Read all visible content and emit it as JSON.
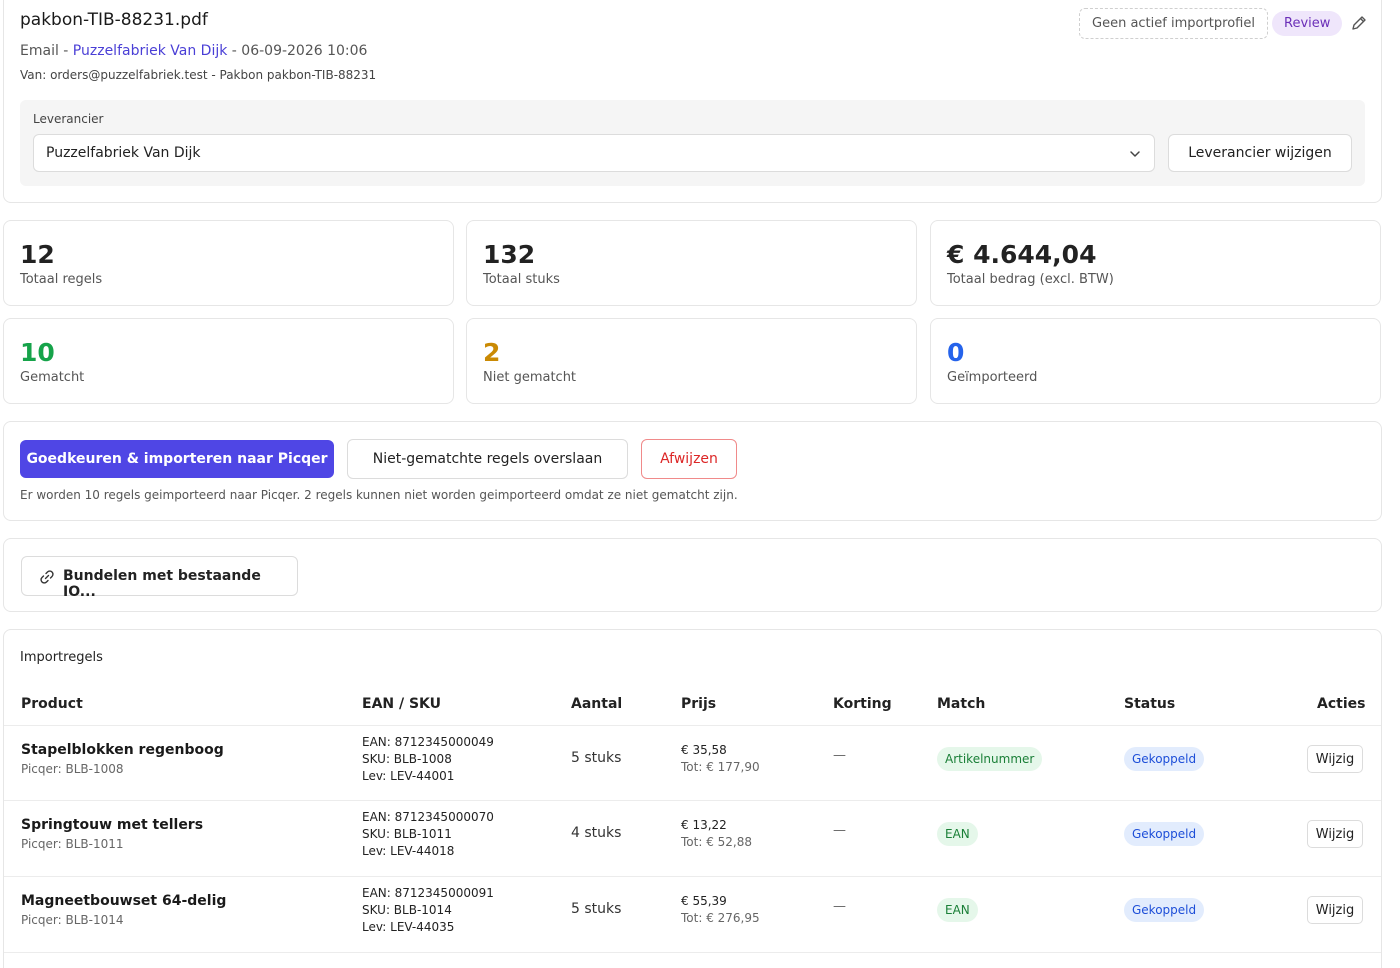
{
  "header": {
    "file_title": "pakbon-TIB-88231.pdf",
    "source": "Email",
    "sep1": " - ",
    "supplier_link": "Puzzelfabriek Van Dijk",
    "sep2": " - ",
    "datetime": "06-09-2026 10:06",
    "from_line": "Van: orders@puzzelfabriek.test - Pakbon pakbon-TIB-88231",
    "profile_badge": "Geen actief importprofiel",
    "review_badge": "Review",
    "edit_icon": "pencil-icon"
  },
  "supplier": {
    "label": "Leverancier",
    "selected": "Puzzelfabriek Van Dijk",
    "change_button": "Leverancier wijzigen"
  },
  "stats": {
    "total_lines": {
      "value": "12",
      "label": "Totaal regels"
    },
    "total_pieces": {
      "value": "132",
      "label": "Totaal stuks"
    },
    "total_amount": {
      "value": "€ 4.644,04",
      "label": "Totaal bedrag (excl. BTW)"
    },
    "matched": {
      "value": "10",
      "label": "Gematcht"
    },
    "unmatched": {
      "value": "2",
      "label": "Niet gematcht"
    },
    "imported": {
      "value": "0",
      "label": "Geïmporteerd"
    }
  },
  "colors": {
    "primary": "#4f46e5",
    "matched": "#16a34a",
    "unmatched": "#ca8a04",
    "imported": "#2563eb",
    "danger": "#dc2626"
  },
  "actions": {
    "approve": "Goedkeuren & importeren naar Picqer",
    "skip": "Niet-gematchte regels overslaan",
    "reject": "Afwijzen",
    "note": "Er worden 10 regels geimporteerd naar Picqer. 2 regels kunnen niet worden geimporteerd omdat ze niet gematcht zijn."
  },
  "bundle": {
    "button": "Bundelen met bestaande IO...",
    "icon": "link-icon"
  },
  "import": {
    "title": "Importregels",
    "columns": [
      "Product",
      "EAN / SKU",
      "Aantal",
      "Prijs",
      "Korting",
      "Match",
      "Status",
      "Acties"
    ],
    "rows": [
      {
        "name": "Stapelblokken regenboog",
        "picqer": "Picqer: BLB-1008",
        "ean": "EAN: 8712345000049",
        "sku": "SKU: BLB-1008",
        "lev": "Lev: LEV-44001",
        "qty": "5 stuks",
        "price": "€ 35,58",
        "total": "Tot: € 177,90",
        "discount": "—",
        "match": "Artikelnummer",
        "status": "Gekoppeld",
        "action": "Wijzig"
      },
      {
        "name": "Springtouw met tellers",
        "picqer": "Picqer: BLB-1011",
        "ean": "EAN: 8712345000070",
        "sku": "SKU: BLB-1011",
        "lev": "Lev: LEV-44018",
        "qty": "4 stuks",
        "price": "€ 13,22",
        "total": "Tot: € 52,88",
        "discount": "—",
        "match": "EAN",
        "status": "Gekoppeld",
        "action": "Wijzig"
      },
      {
        "name": "Magneetbouwset 64-delig",
        "picqer": "Picqer: BLB-1014",
        "ean": "EAN: 8712345000091",
        "sku": "SKU: BLB-1014",
        "lev": "Lev: LEV-44035",
        "qty": "5 stuks",
        "price": "€ 55,39",
        "total": "Tot: € 276,95",
        "discount": "—",
        "match": "EAN",
        "status": "Gekoppeld",
        "action": "Wijzig"
      }
    ]
  }
}
